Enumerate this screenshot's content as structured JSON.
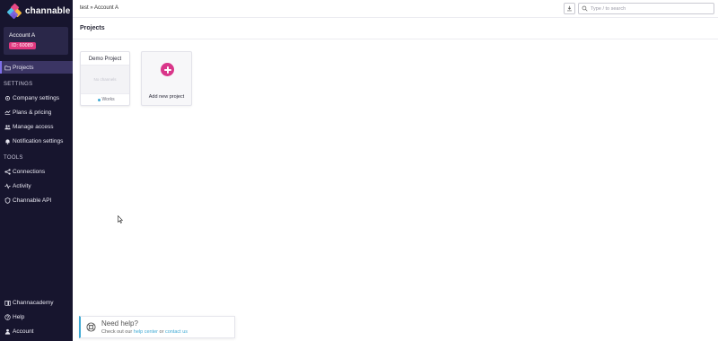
{
  "brand": {
    "name": "channable"
  },
  "account": {
    "name": "Account A",
    "id": "ID: 60089"
  },
  "nav": {
    "projects": "Projects",
    "settings_title": "SETTINGS",
    "settings": [
      "Company settings",
      "Plans & pricing",
      "Manage access",
      "Notification settings"
    ],
    "tools_title": "TOOLS",
    "tools": [
      "Connections",
      "Activity",
      "Channable API"
    ],
    "bottom": [
      "Channacademy",
      "Help",
      "Account"
    ]
  },
  "topbar": {
    "breadcrumb": "test » Account A",
    "search_placeholder": "Type / to search"
  },
  "page": {
    "title": "Projects"
  },
  "projects": [
    {
      "name": "Demo Project",
      "preview": "No channels",
      "status": "Works"
    }
  ],
  "add_project_label": "Add new project",
  "help": {
    "title": "Need help?",
    "text_prefix": "Check out our ",
    "help_center": "help center",
    "or": " or ",
    "contact": "contact us"
  },
  "colors": {
    "sidebar_bg": "#17152e",
    "accent_pink": "#d9368a",
    "accent_blue": "#3fa9d4",
    "active_item": "#3b3564"
  }
}
